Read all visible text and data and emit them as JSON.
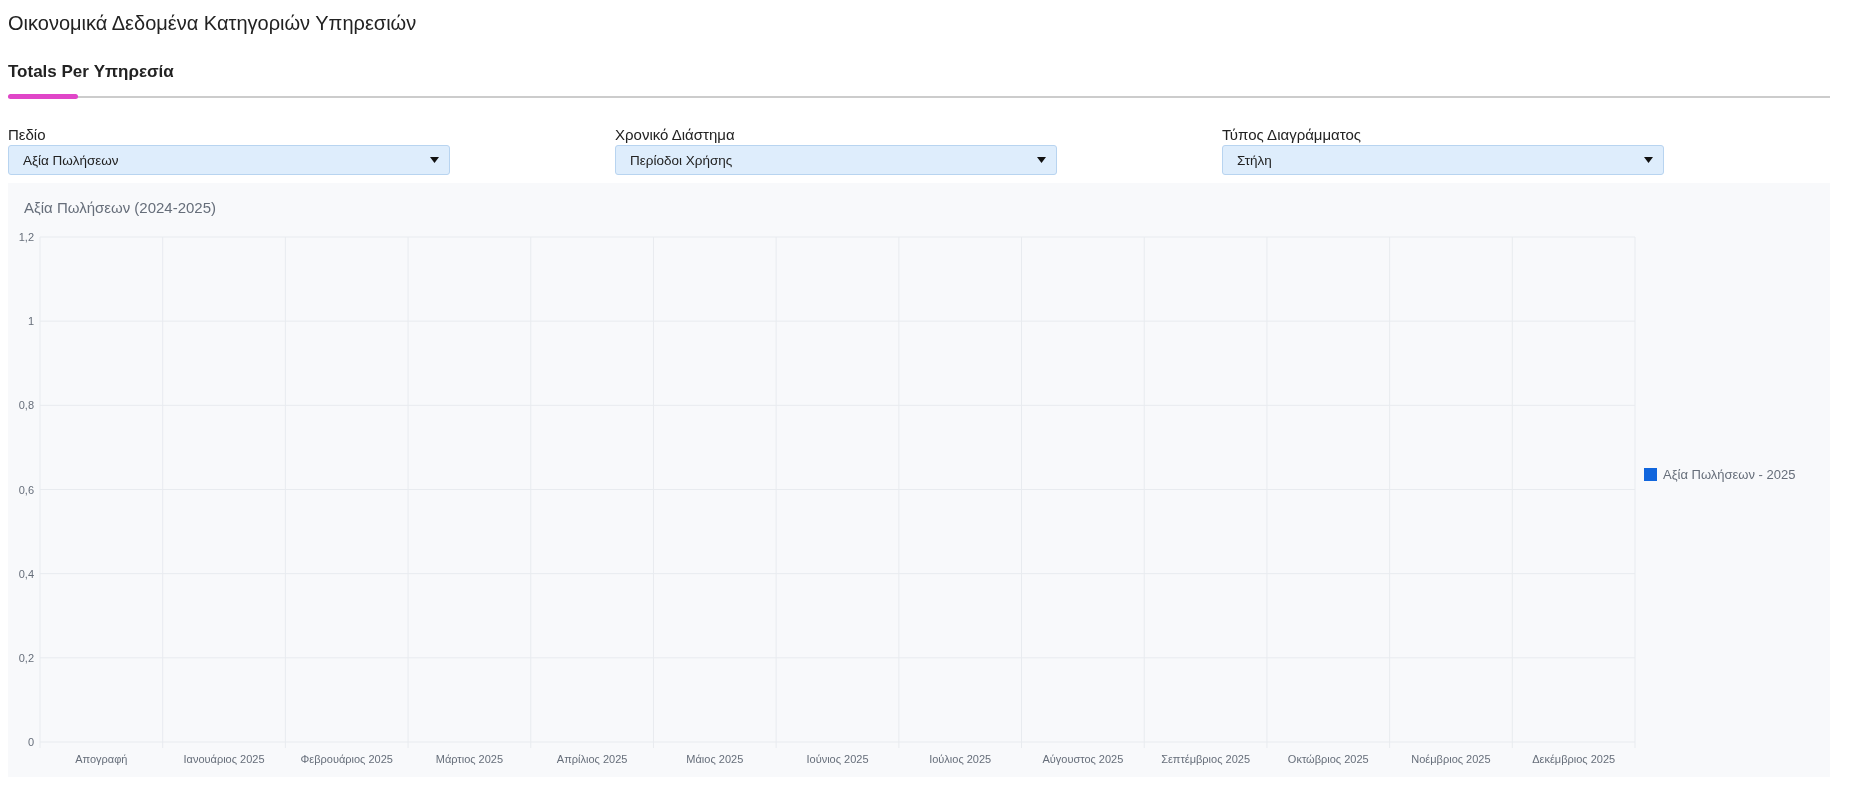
{
  "page": {
    "title": "Οικονομικά Δεδομένα Κατηγοριών Υπηρεσιών"
  },
  "tabs": [
    {
      "label": "Totals Per Υπηρεσία",
      "selected": true
    }
  ],
  "filters": [
    {
      "label": "Πεδίο",
      "value": "Αξία Πωλήσεων"
    },
    {
      "label": "Χρονικό Διάστημα",
      "value": "Περίοδοι Χρήσης"
    },
    {
      "label": "Τύπος Διαγράμματος",
      "value": "Στήλη"
    }
  ],
  "chart": {
    "chart_data": {
      "type": "bar",
      "title": "Αξία Πωλήσεων (2024-2025)",
      "categories": [
        "Απογραφή",
        "Ιανουάριος 2025",
        "Φεβρουάριος 2025",
        "Μάρτιος 2025",
        "Απρίλιος 2025",
        "Μάιος 2025",
        "Ιούνιος 2025",
        "Ιούλιος 2025",
        "Αύγουστος 2025",
        "Σεπτέμβριος 2025",
        "Οκτώβριος 2025",
        "Νοέμβριος 2025",
        "Δεκέμβριος 2025"
      ],
      "series": [
        {
          "name": "Αξία Πωλήσεων - 2025",
          "color": "#1166dd",
          "values": [
            null,
            null,
            null,
            null,
            null,
            null,
            null,
            null,
            null,
            null,
            null,
            null,
            null
          ]
        }
      ],
      "ylim": [
        0,
        1.2
      ],
      "grid": true,
      "yticks": [
        {
          "value": 0,
          "label": "0"
        },
        {
          "value": 0.2,
          "label": "0,2"
        },
        {
          "value": 0.4,
          "label": "0,4"
        },
        {
          "value": 0.6,
          "label": "0,6"
        },
        {
          "value": 0.8,
          "label": "0,8"
        },
        {
          "value": 1,
          "label": "1"
        },
        {
          "value": 1.2,
          "label": "1,2"
        }
      ]
    }
  }
}
